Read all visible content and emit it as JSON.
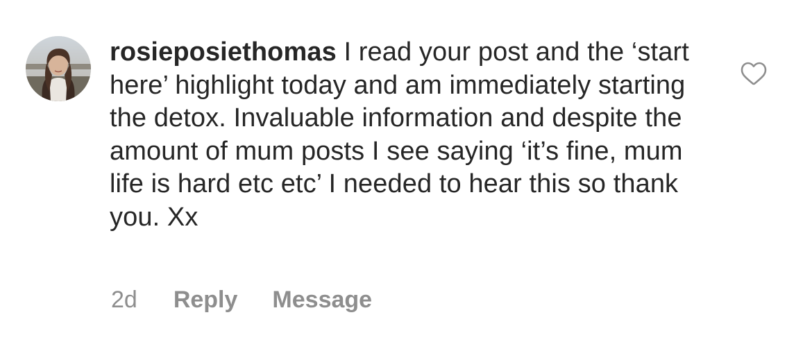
{
  "comment": {
    "username": "rosieposiethomas",
    "text": "I read your post and the ‘start here’ highlight today and am immediately starting the detox. Invaluable information and despite the amount of mum posts I see saying ‘it’s fine, mum life is hard etc etc’ I needed to hear this so thank you. Xx",
    "timestamp": "2d",
    "reply_label": "Reply",
    "message_label": "Message"
  },
  "icons": {
    "like": "heart-outline-icon",
    "avatar": "user-profile-photo"
  },
  "colors": {
    "text": "#262626",
    "secondary": "#8e8e8e",
    "icon": "#8e8e8e",
    "background": "#ffffff"
  }
}
